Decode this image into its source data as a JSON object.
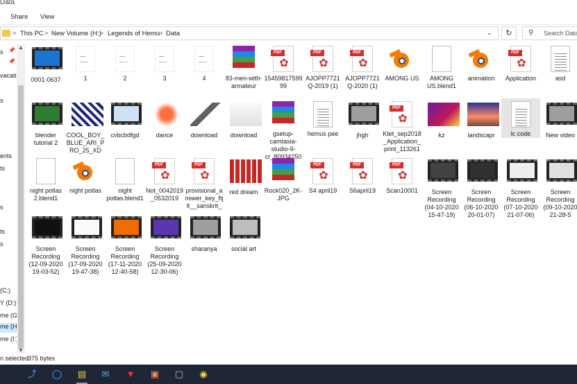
{
  "window": {
    "title": "Data"
  },
  "menu": {
    "share": "Share",
    "view": "View"
  },
  "address": {
    "crumbs": [
      "This PC",
      "New Volume (H:)",
      "Legends of Hemu",
      "Data"
    ],
    "separator": ">",
    "dropdown_icon": "chevron-down-icon",
    "refresh_icon": "refresh-icon"
  },
  "search": {
    "placeholder": "Search Data",
    "icon": "search-icon"
  },
  "nav": {
    "items": [
      "s",
      "vacati",
      "s",
      "ents",
      "ts",
      "s",
      "ts",
      "s",
      "(C:)",
      "Y (D:)",
      "me (G:",
      "me (H:",
      "me (I:)"
    ]
  },
  "files": [
    {
      "name": "0001-0637",
      "type": "video-blue"
    },
    {
      "name": "1",
      "type": "doc-sketch"
    },
    {
      "name": "2",
      "type": "doc-sketch"
    },
    {
      "name": "3",
      "type": "doc-sketch"
    },
    {
      "name": "4",
      "type": "doc-sketch"
    },
    {
      "name": "83-men-with-armateur",
      "type": "rar"
    },
    {
      "name": "1545981759999",
      "type": "pdf"
    },
    {
      "name": "AJOPP7721Q-2019 (1)",
      "type": "pdf"
    },
    {
      "name": "AJOPP7721Q-2020 (1)",
      "type": "pdf"
    },
    {
      "name": "AMONG US",
      "type": "blender"
    },
    {
      "name": "AMONG US.blend1",
      "type": "doc"
    },
    {
      "name": "animation",
      "type": "blender"
    },
    {
      "name": "Application",
      "type": "pdf"
    },
    {
      "name": "asd",
      "type": "doc-lines"
    },
    {
      "name": "blender tutorial 2",
      "type": "video-green"
    },
    {
      "name": "COOL_BOY_BLUE_ARI_PRO_25_XD",
      "type": "img-pixel"
    },
    {
      "name": "cvbcbdfgd",
      "type": "video-blue2"
    },
    {
      "name": "dance",
      "type": "img-dance"
    },
    {
      "name": "download",
      "type": "img-axe"
    },
    {
      "name": "download",
      "type": "img-map"
    },
    {
      "name": "gsetup-camtasia-studio-9-cr_8093425056...",
      "type": "rar"
    },
    {
      "name": "hemus pee",
      "type": "doc-lines"
    },
    {
      "name": "jhgh",
      "type": "video-gray"
    },
    {
      "name": "Ktet_sep2018_Application_print_113261",
      "type": "pdf"
    },
    {
      "name": "kz",
      "type": "img-kz"
    },
    {
      "name": "landscapr",
      "type": "img-landscape"
    },
    {
      "name": "lc code",
      "type": "doc-lines-sel"
    },
    {
      "name": "New video",
      "type": "video-gray"
    },
    {
      "name": "night potlas 2.blend1",
      "type": "doc"
    },
    {
      "name": "night potlas",
      "type": "blender"
    },
    {
      "name": "night potlas.blend1",
      "type": "doc"
    },
    {
      "name": "Not_0042019_0532019",
      "type": "pdf"
    },
    {
      "name": "provisional_answer_key_ftjlt__sanskrit_",
      "type": "pdf"
    },
    {
      "name": "red dream",
      "type": "img-red"
    },
    {
      "name": "Rock020_2K-JPG",
      "type": "rar"
    },
    {
      "name": "S4 april19",
      "type": "pdf"
    },
    {
      "name": "S6april19",
      "type": "pdf"
    },
    {
      "name": "Scan10001",
      "type": "pdf"
    },
    {
      "name": "Screen Recording (04-10-2020 15-47-19)",
      "type": "video-dark"
    },
    {
      "name": "Screen Recording (06-10-2020 20-01-07)",
      "type": "video-dark2"
    },
    {
      "name": "Screen Recording (07-10-2020 21-07-06)",
      "type": "video-light"
    },
    {
      "name": "Screen Recording (09-10-2020 21-28-5",
      "type": "video-light2"
    },
    {
      "name": "Screen Recording (12-09-2020 19-03-52)",
      "type": "video-black"
    },
    {
      "name": "Screen Recording (17-09-2020 19-47-38)",
      "type": "video-white"
    },
    {
      "name": "Screen Recording (17-11-2020 12-40-58)",
      "type": "video-orange"
    },
    {
      "name": "Screen Recording (25-09-2020 12-30-06)",
      "type": "video-purple"
    },
    {
      "name": "sharanya",
      "type": "video-gray"
    },
    {
      "name": "social art",
      "type": "video-gray2"
    }
  ],
  "status": {
    "selected": "n selected",
    "size": "375 bytes"
  },
  "taskbar": {
    "icons": [
      "cortana-icon",
      "edge-icon",
      "file-explorer-icon",
      "mail-icon",
      "mcafee-icon",
      "photos-icon",
      "snipping-icon",
      "chrome-icon"
    ]
  },
  "colors": {
    "accent": "#0078d7",
    "taskbar": "#1f2736",
    "pdf_red": "#d32f2f",
    "selection": "#cce8ff"
  }
}
